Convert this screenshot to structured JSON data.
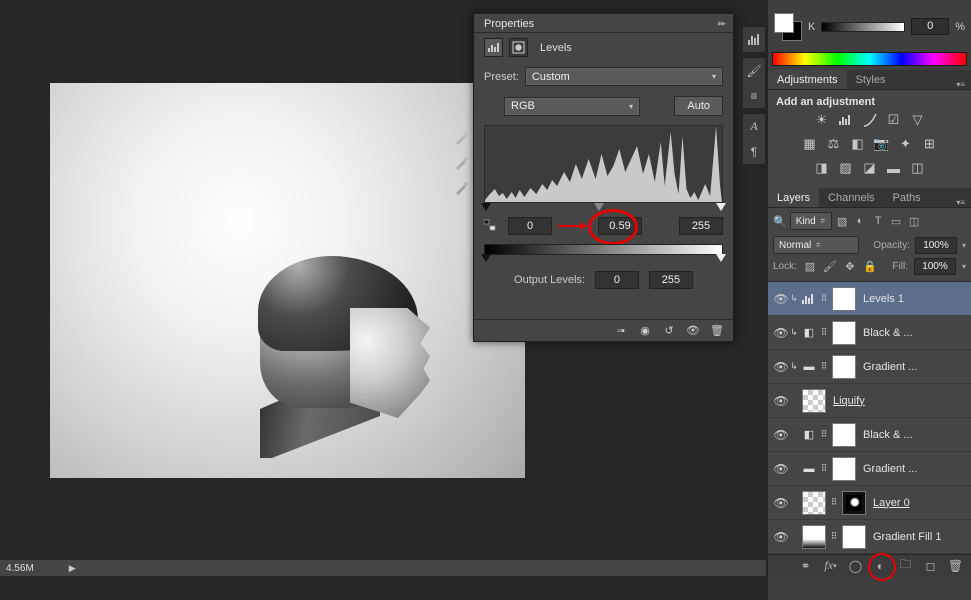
{
  "properties": {
    "panel_title": "Properties",
    "adjustment_type": "Levels",
    "preset_label": "Preset:",
    "preset_value": "Custom",
    "channel_value": "RGB",
    "auto_label": "Auto",
    "input_black": "0",
    "input_gamma": "0.59",
    "input_white": "255",
    "output_label": "Output Levels:",
    "output_black": "0",
    "output_white": "255"
  },
  "color": {
    "mode_label": "K",
    "value": "0",
    "unit": "%"
  },
  "adjustments": {
    "tab": "Adjustments",
    "tab2": "Styles",
    "heading": "Add an adjustment"
  },
  "layers": {
    "tabs": [
      "Layers",
      "Channels",
      "Paths"
    ],
    "filter_kind": "Kind",
    "blend_mode": "Normal",
    "opacity_label": "Opacity:",
    "opacity_value": "100%",
    "lock_label": "Lock:",
    "fill_label": "Fill:",
    "fill_value": "100%",
    "items": [
      {
        "name": "Levels 1",
        "adjust": "levels",
        "sel": true,
        "clip": true
      },
      {
        "name": "Black & ...",
        "adjust": "bw",
        "clip": true
      },
      {
        "name": "Gradient ...",
        "adjust": "grad",
        "clip": true
      },
      {
        "name": "Liquify",
        "type": "smart",
        "underline": true
      },
      {
        "name": "Black & ...",
        "adjust": "bw"
      },
      {
        "name": "Gradient ...",
        "adjust": "grad"
      },
      {
        "name": "Layer 0",
        "type": "image",
        "underline": true
      },
      {
        "name": "Gradient Fill 1",
        "adjust": "gradfill"
      }
    ]
  },
  "status": {
    "zoom": "4.56M"
  }
}
